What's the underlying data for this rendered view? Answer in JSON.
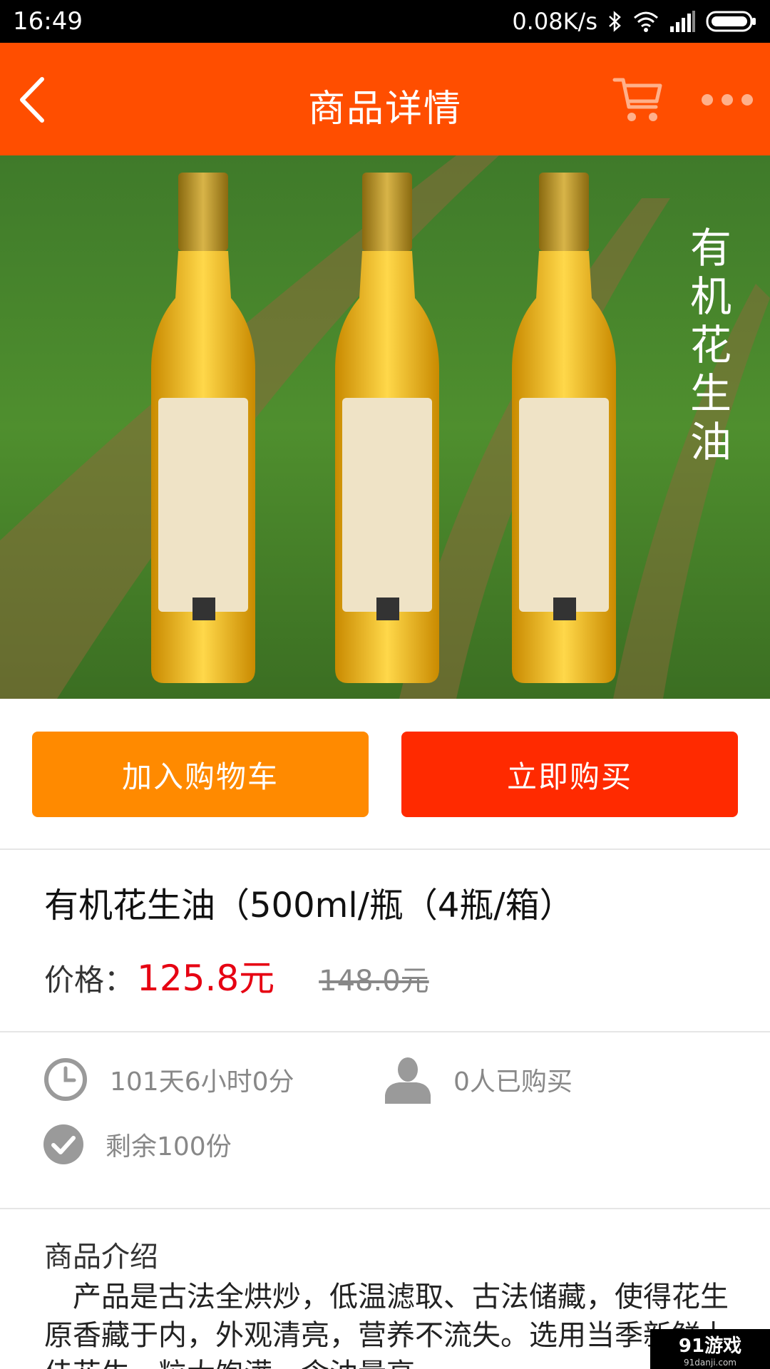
{
  "status_bar": {
    "time": "16:49",
    "network_speed": "0.08K/s",
    "icons": [
      "bluetooth-icon",
      "wifi-icon",
      "signal-icon",
      "battery-icon"
    ]
  },
  "header": {
    "title": "商品详情",
    "bg_color": "#ff4e00"
  },
  "image": {
    "overlay_text": [
      "有",
      "机",
      "花",
      "生",
      "油"
    ]
  },
  "actions": {
    "add_to_cart": "加入购物车",
    "buy_now": "立即购买",
    "add_color": "#ff8a00",
    "buy_color": "#ff2a00"
  },
  "product": {
    "name": "有机花生油（500ml/瓶（4瓶/箱）",
    "price_label": "价格：",
    "price": "125.8元",
    "original_price": "148.0元",
    "price_color": "#e60012"
  },
  "meta": {
    "time_left": "101天6小时0分",
    "buyers": "0人已购买",
    "remaining": "剩余100份"
  },
  "description": {
    "title": "商品介绍",
    "text": "产品是古法全烘炒，低温滤取、古法储藏，使得花生原香藏于内，外观清亮，营养不流失。选用当季新鲜上佳花生，粒大饱满，含油量高"
  },
  "watermark": {
    "main": "91游戏",
    "sub": "91danji.com"
  }
}
